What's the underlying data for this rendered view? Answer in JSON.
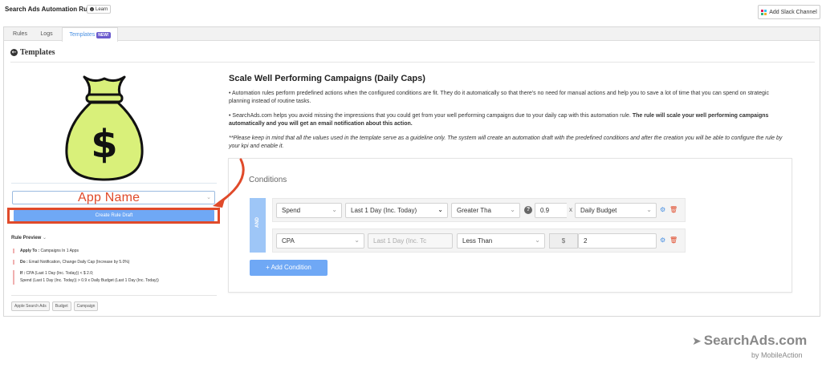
{
  "header": {
    "app_title": "Search Ads Automation Rules",
    "learn_label": "Learn",
    "slack_button": "Add Slack Channel"
  },
  "tabs": [
    {
      "label": "Rules"
    },
    {
      "label": "Logs"
    },
    {
      "label": "Templates",
      "badge": "NEW!"
    }
  ],
  "templates": {
    "heading": "Templates",
    "app_name_overlay": "App Name",
    "create_button": "Create Rule Draft",
    "rule_preview_label": "Rule Preview",
    "apply_to_label": "Apply To :",
    "apply_to_value": "Campaigns In 1 Apps",
    "do_label": "Do :",
    "do_value": "Email Notification, Change Daily Cap (Increase by 5.0%)",
    "if_label": "If :",
    "if_line1": "CPA (Last 1 Day (Inc. Today)) < $ 2.0;",
    "if_line2": "Spend (Last 1 Day (Inc. Today)) > 0.9 x Daily Budget (Last 1 Day (Inc. Today))",
    "tags": [
      "Apple Search Ads",
      "Budget",
      "Campaign"
    ]
  },
  "detail": {
    "title": "Scale Well Performing Campaigns (Daily Caps)",
    "para1": "• Automation rules perform predefined actions when the configured conditions are fit. They do it automatically so that there's no need for manual actions and help you to save a lot of time that you can spend on strategic planning instead of routine tasks.",
    "para2_a": "• SearchAds.com helps you avoid missing the impressions that you could get from your well performing campaigns due to your daily cap with this automation rule.",
    "para2_b": "The rule will scale your well performing campaigns automatically and you will get an email notification about this action.",
    "note": "**Please keep in mind that all the values used in the template serve as a guideline only. The system will create an automation draft with the predefined conditions and after the creation you will be able to configure the rule by your kpi and enable it."
  },
  "conditions": {
    "title": "Conditions",
    "and_label": "AND",
    "row1": {
      "metric": "Spend",
      "period": "Last 1 Day (Inc. Today)",
      "operator": "Greater Tha",
      "value": "0.9",
      "multiplier": "x",
      "compare": "Daily Budget"
    },
    "row2": {
      "metric": "CPA",
      "period": "Last 1 Day (Inc. Tc",
      "operator": "Less Than",
      "currency": "$",
      "value": "2"
    },
    "add_button": "Add Condition"
  },
  "brand": {
    "name": "SearchAds.com",
    "sub": "by MobileAction"
  },
  "colors": {
    "accent": "#6fa8f5",
    "annotation": "#e04a2a",
    "bag": "#d9f07a"
  }
}
